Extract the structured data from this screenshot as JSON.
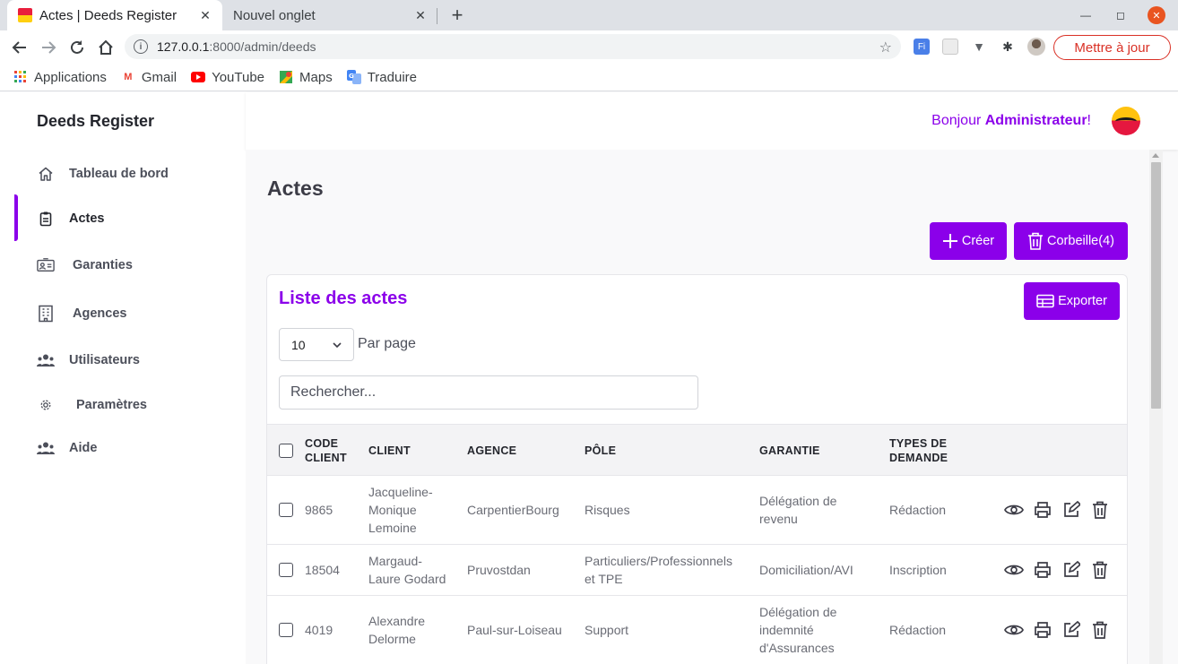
{
  "browser": {
    "tabs": [
      {
        "title": "Actes | Deeds Register",
        "active": true
      },
      {
        "title": "Nouvel onglet",
        "active": false
      }
    ],
    "url_host": "127.0.0.1",
    "url_path": ":8000/admin/deeds",
    "update_label": "Mettre à jour",
    "bookmarks": [
      "Applications",
      "Gmail",
      "YouTube",
      "Maps",
      "Traduire"
    ]
  },
  "app": {
    "brand": "Deeds Register",
    "greeting_prefix": "Bonjour ",
    "greeting_user": "Administrateur",
    "greeting_suffix": "!",
    "nav": [
      {
        "label": "Tableau de bord",
        "icon": "home-icon"
      },
      {
        "label": "Actes",
        "icon": "clipboard-icon",
        "active": true
      },
      {
        "label": "Garanties",
        "icon": "id-card-icon"
      },
      {
        "label": "Agences",
        "icon": "building-icon"
      },
      {
        "label": "Utilisateurs",
        "icon": "users-icon"
      },
      {
        "label": "Paramètres",
        "icon": "gear-icon"
      },
      {
        "label": "Aide",
        "icon": "users-icon"
      }
    ],
    "accent_color": "#8b00ea"
  },
  "page": {
    "title": "Actes",
    "create_label": "Créer",
    "trash_label": "Corbeille(4)",
    "card": {
      "title": "Liste des actes",
      "export_label": "Exporter",
      "per_page_value": "10",
      "per_page_label": "Par page",
      "search_placeholder": "Rechercher..."
    },
    "table": {
      "columns": [
        "CODE CLIENT",
        "CLIENT",
        "AGENCE",
        "PÔLE",
        "GARANTIE",
        "TYPES DE DEMANDE"
      ],
      "rows": [
        {
          "code": "9865",
          "client": "Jacqueline-Monique Lemoine",
          "agence": "CarpentierBourg",
          "pole": "Risques",
          "garantie": "Délégation de revenu",
          "type": "Rédaction"
        },
        {
          "code": "18504",
          "client": "Margaud-Laure Godard",
          "agence": "Pruvostdan",
          "pole": "Particuliers/Professionnels et TPE",
          "garantie": "Domiciliation/AVI",
          "type": "Inscription"
        },
        {
          "code": "4019",
          "client": "Alexandre Delorme",
          "agence": "Paul-sur-Loiseau",
          "pole": "Support",
          "garantie": "Délégation de indemnité d'Assurances",
          "type": "Rédaction"
        }
      ]
    }
  }
}
